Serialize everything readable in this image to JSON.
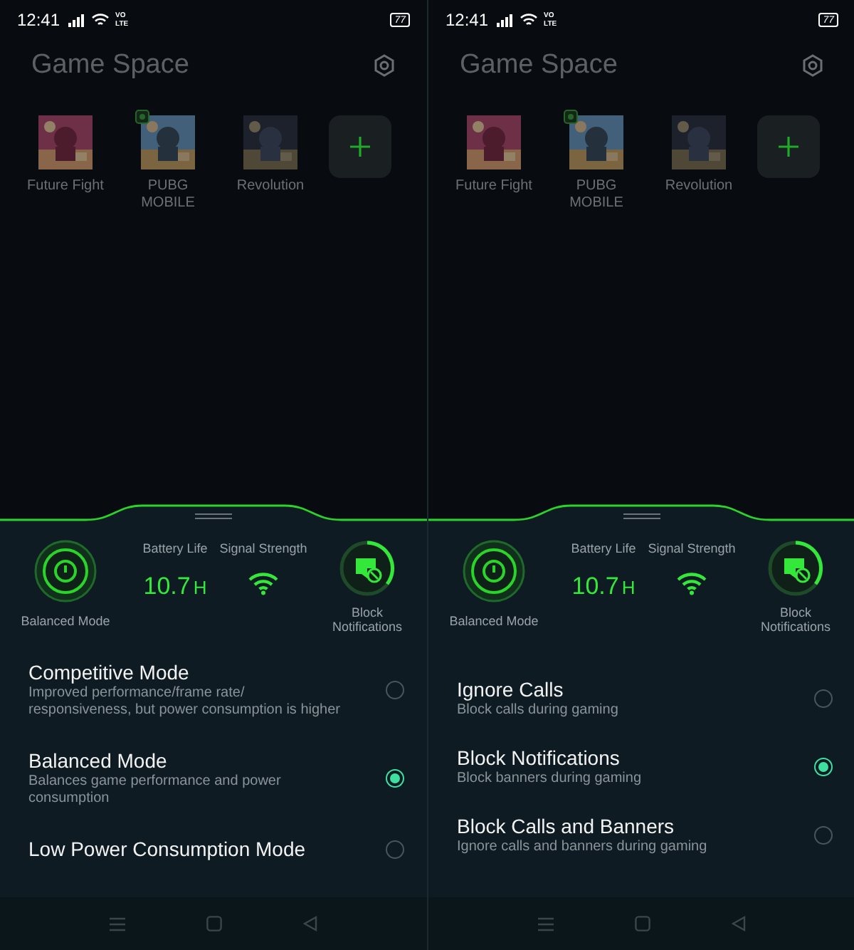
{
  "screens": [
    {
      "status_bar": {
        "time": "12:41",
        "network": [
          "VO",
          "LTE"
        ],
        "battery": "77"
      },
      "title": "Game Space",
      "games": [
        {
          "name": "Future Fight",
          "badge": false
        },
        {
          "name": "PUBG MOBILE",
          "badge": true
        },
        {
          "name": "Revolution",
          "badge": false
        }
      ],
      "stats": {
        "mode": "Balanced Mode",
        "battery_label": "Battery Life",
        "battery_value": "10.7",
        "battery_unit": "H",
        "signal_label": "Signal Strength",
        "block": "Block Notifications"
      },
      "options": [
        {
          "title": "Competitive Mode",
          "description": "Improved performance/frame rate/ responsiveness, but power consumption is higher",
          "selected": false
        },
        {
          "title": "Balanced Mode",
          "description": "Balances game performance and power consumption",
          "selected": true
        },
        {
          "title": "Low Power Consumption Mode",
          "selected": false
        }
      ]
    },
    {
      "status_bar": {
        "time": "12:41",
        "network": [
          "VO",
          "LTE"
        ],
        "battery": "77"
      },
      "title": "Game Space",
      "games": [
        {
          "name": "Future Fight",
          "badge": false
        },
        {
          "name": "PUBG MOBILE",
          "badge": true
        },
        {
          "name": "Revolution",
          "badge": false
        }
      ],
      "stats": {
        "mode": "Balanced Mode",
        "battery_label": "Battery Life",
        "battery_value": "10.7",
        "battery_unit": "H",
        "signal_label": "Signal Strength",
        "block": "Block Notifications"
      },
      "options": [
        {
          "title": "Ignore Calls",
          "description": "Block calls during gaming",
          "selected": false
        },
        {
          "title": "Block Notifications",
          "description": "Block banners during gaming",
          "selected": true
        },
        {
          "title": "Block Calls and Banners",
          "description": "Ignore calls and banners during gaming",
          "selected": false
        }
      ]
    }
  ]
}
